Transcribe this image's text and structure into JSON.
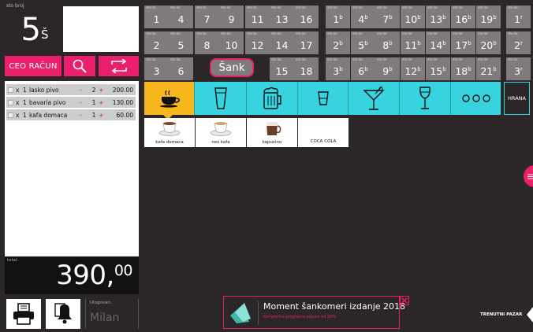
{
  "table": {
    "label": "sto broj",
    "number": "5",
    "suffix": "Š"
  },
  "actions": {
    "ceo_racun": "CEO RAČUN"
  },
  "order": {
    "items": [
      {
        "x": "x",
        "qty": "1",
        "name": "lasko pivo",
        "minus": "-",
        "count": "2",
        "plus": "+",
        "price": "200.00"
      },
      {
        "x": "x",
        "qty": "1",
        "name": "bavaria pivo",
        "minus": "-",
        "count": "1",
        "plus": "+",
        "price": "130.00"
      },
      {
        "x": "x",
        "qty": "1",
        "name": "kafa domaca",
        "minus": "-",
        "count": "1",
        "plus": "+",
        "price": "60.00"
      }
    ]
  },
  "total": {
    "label": "total:",
    "main": "390,",
    "cents": "00"
  },
  "user": {
    "label": "Ulogovan:",
    "name": "Milan"
  },
  "grid": {
    "cell_label": "sto br.",
    "sank_label": "Šank",
    "block1": [
      [
        "1",
        "4",
        "7",
        "9",
        "11",
        "13",
        "16"
      ],
      [
        "2",
        "5",
        "8",
        "10",
        "12",
        "14",
        "17"
      ],
      [
        "3",
        "6",
        "",
        "",
        "",
        "15",
        "18"
      ]
    ],
    "block2_base": [
      [
        "1",
        "4",
        "7",
        "10",
        "13",
        "16",
        "19"
      ],
      [
        "2",
        "5",
        "8",
        "11",
        "14",
        "17",
        "20"
      ],
      [
        "3",
        "6",
        "9",
        "12",
        "15",
        "18",
        "21"
      ]
    ],
    "block2_sup": "b",
    "block3": [
      {
        "n": "1",
        "s": "r"
      },
      {
        "n": "2",
        "s": "r"
      },
      {
        "n": "3",
        "s": "r"
      }
    ]
  },
  "categories": {
    "icons": [
      "coffee-cup-icon",
      "beer-glass-icon",
      "beer-mug-icon",
      "shot-glass-icon",
      "cocktail-glass-icon",
      "wine-glass-icon",
      "more-dots-icon"
    ],
    "hrana": "HRANA",
    "colors": {
      "active": "#f8b71f",
      "inactive": "#37d4e0"
    }
  },
  "items": [
    {
      "label": "kafa domaca",
      "icon": "coffee-cup-icon"
    },
    {
      "label": "nes kafa",
      "icon": "coffee-cup-icon"
    },
    {
      "label": "kapucino",
      "icon": "cappuccino-icon"
    },
    {
      "label": "COCA COLA",
      "icon": ""
    }
  ],
  "ad": {
    "title": "Moment šankomeri izdanje 2018",
    "subtitle": "Kompletna programa popust od 20%"
  },
  "footer": {
    "trenutni_pazar": "TRENUTNI PAZAR"
  },
  "colors": {
    "brand_pink": "#ec1f6d",
    "background": "#2b2728",
    "tile_gray": "#7f7b7c"
  }
}
